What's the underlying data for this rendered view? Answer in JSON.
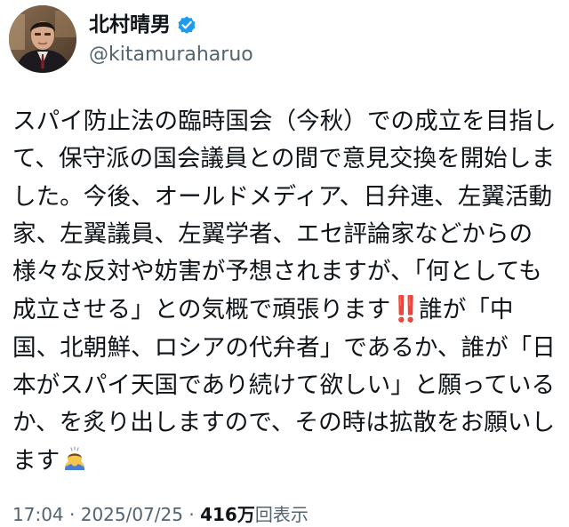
{
  "author": {
    "display_name": "北村晴男",
    "handle": "@kitamuraharuo",
    "verified_icon": "verified-badge-icon",
    "verified_color": "#1d9bf0"
  },
  "post": {
    "text_before_emoji": "スパイ防止法の臨時国会（今秋）での成立を目指して、保守派の国会議員との間で意見交換を開始しました。今後、オールドメディア、日弁連、左翼活動家、左翼議員、左翼学者、エセ評論家などからの様々な反対や妨害が予想されますが、「何としても成立させる」との気概で頑張ります",
    "emoji_1": "‼️",
    "text_after_emoji": "誰が「中国、北朝鮮、ロシアの代弁者」であるか、誰が「日本がスパイ天国であり続けて欲しい」と願っているか、を炙り出しますので、その時は拡散をお願いします",
    "emoji_2": "person-bowing-emoji"
  },
  "meta": {
    "time": "17:04",
    "separator": " · ",
    "date": "2025/07/25",
    "views_count": "416万",
    "views_label": "回表示"
  }
}
